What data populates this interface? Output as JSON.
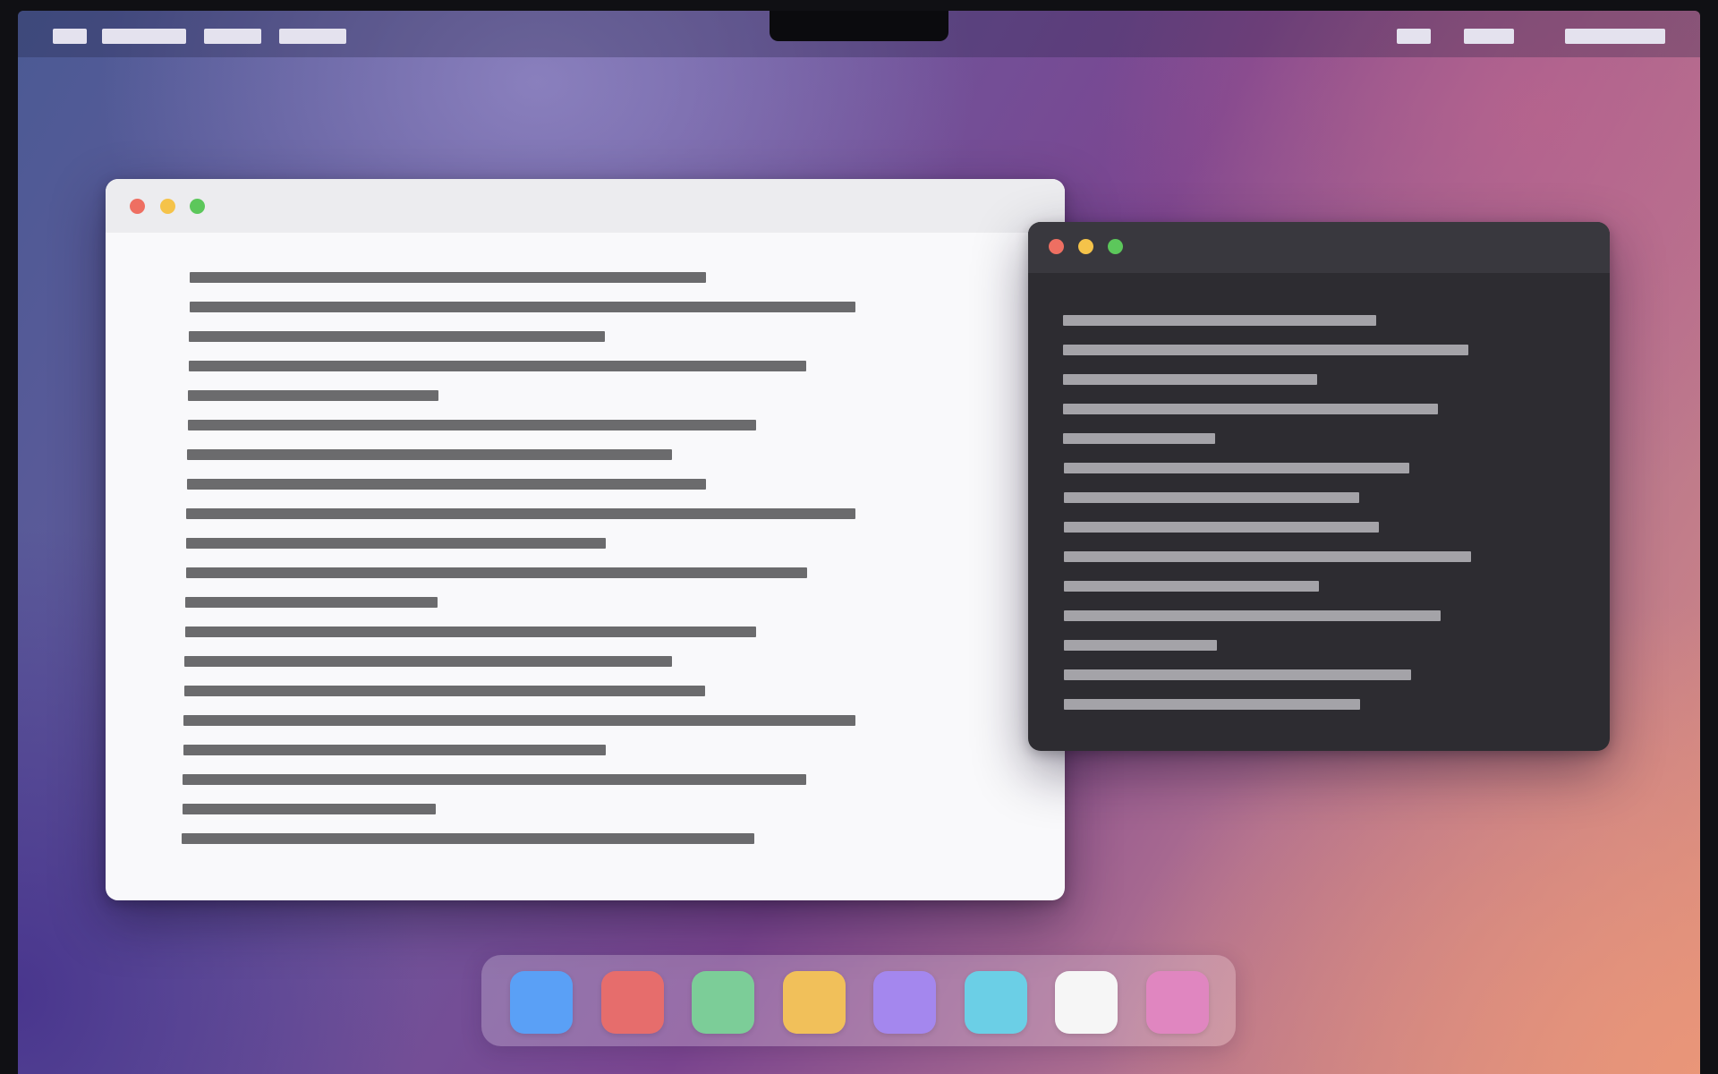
{
  "menubar": {
    "left_items": [
      "",
      "",
      "",
      ""
    ],
    "right_items": [
      "",
      "",
      ""
    ],
    "item_color": "#e4e2ee"
  },
  "windows": {
    "document": {
      "traffic_lights": [
        "close-icon",
        "minimize-icon",
        "maximize-icon"
      ],
      "text_line_count": 20,
      "text_color": "#6b6b6d",
      "background_color": "#f9f9fb"
    },
    "terminal": {
      "traffic_lights": [
        "close-icon",
        "minimize-icon",
        "maximize-icon"
      ],
      "text_line_count": 14,
      "text_color": "#a4a3a8",
      "background_color": "#2d2c31"
    }
  },
  "traffic_light_colors": {
    "close": "#ee6f62",
    "minimize": "#f5c34a",
    "maximize": "#5cc75b"
  },
  "dock": {
    "apps": [
      {
        "icon": "blue-app-icon",
        "color": "#5aa0f6"
      },
      {
        "icon": "red-app-icon",
        "color": "#e66d6c"
      },
      {
        "icon": "green-app-icon",
        "color": "#7ccd98"
      },
      {
        "icon": "yellow-app-icon",
        "color": "#f1c05a"
      },
      {
        "icon": "purple-app-icon",
        "color": "#a487ee"
      },
      {
        "icon": "cyan-app-icon",
        "color": "#6bcfe6"
      },
      {
        "icon": "white-app-icon",
        "color": "#f6f6f6"
      },
      {
        "icon": "pink-app-icon",
        "color": "#e086c0"
      }
    ]
  }
}
